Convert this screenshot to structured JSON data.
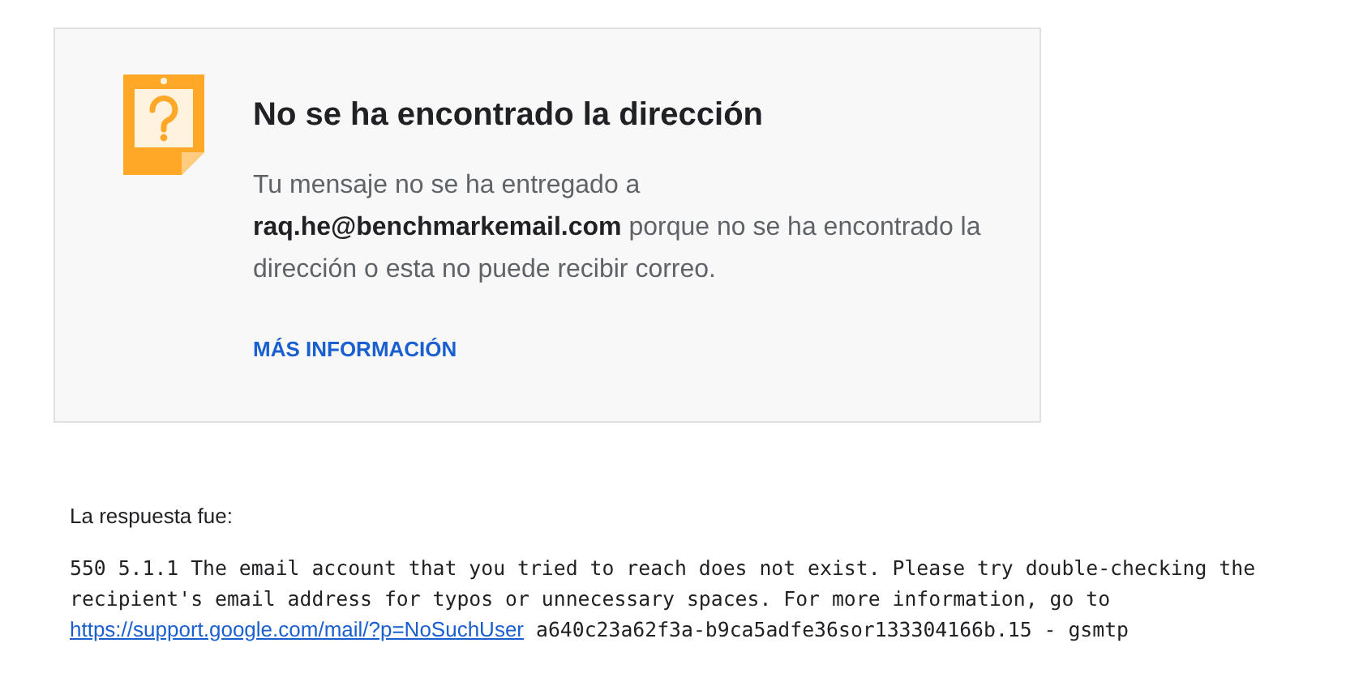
{
  "card": {
    "title": "No se ha encontrado la dirección",
    "message": "Tu mensaje no se ha entregado a **raq.he@benchmarkemail.com** porque no se ha encontrado la dirección o esta no puede recibir correo.",
    "link": "MÁS INFORMACIÓN"
  },
  "response": {
    "label": "La respuesta fue:",
    "text": "550 5.1.1 The email account that you tried to reach does not exist. Please try double-checking the recipient's email address for typos or unnecessary spaces. For more information, go to",
    "link": "https://support.google.com/mail/?p=NoSuchUser",
    "suffix": "a640c23a62f3a-b9ca5adfe36sor133304166b.15 - gsmtp"
  }
}
